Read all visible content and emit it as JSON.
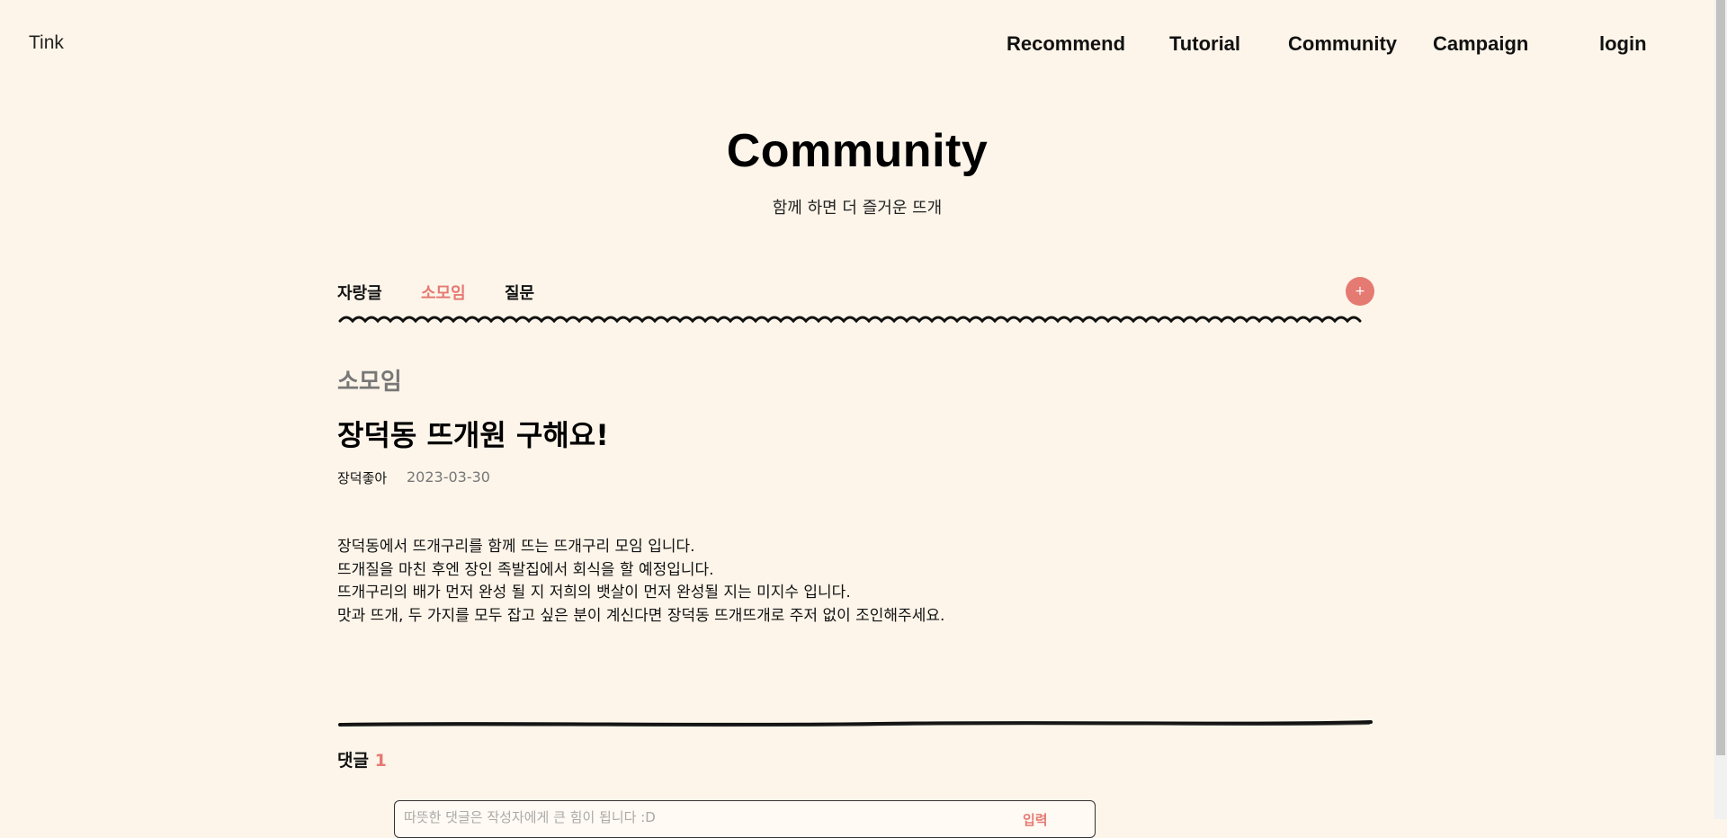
{
  "nav": {
    "logo": "Tink",
    "links": [
      "Recommend",
      "Tutorial",
      "Community",
      "Campaign"
    ],
    "login": "login"
  },
  "hero": {
    "title": "Community",
    "subtitle": "함께 하면 더 즐거운 뜨개"
  },
  "tabs": [
    {
      "label": "자랑글",
      "active": false
    },
    {
      "label": "소모임",
      "active": true
    },
    {
      "label": "질문",
      "active": false
    }
  ],
  "add_button": {
    "label": "+",
    "color": "#e57a73"
  },
  "post": {
    "category": "소모임",
    "title": "장덕동 뜨개원 구해요!",
    "author": "장덕좋아",
    "date": "2023-03-30",
    "body": [
      "장덕동에서 뜨개구리를 함께 뜨는 뜨개구리 모임 입니다.",
      "뜨개질을 마친 후엔 장인 족발집에서 회식을 할 예정입니다.",
      "뜨개구리의 배가 먼저 완성 될 지 저희의 뱃살이 먼저 완성될 지는 미지수 입니다.",
      "맛과 뜨개, 두 가지를 모두 잡고 싶은 분이 계신다면 장덕동 뜨개뜨개로 주저 없이 조인해주세요."
    ]
  },
  "comments": {
    "heading": "댓글",
    "count": "1",
    "input_placeholder": "따뜻한 댓글은 작성자에게 큰 힘이 됩니다 :D",
    "submit_label": "입력"
  },
  "colors": {
    "background": "#fdf5ea",
    "accent": "#e57a73",
    "text": "#111111"
  }
}
